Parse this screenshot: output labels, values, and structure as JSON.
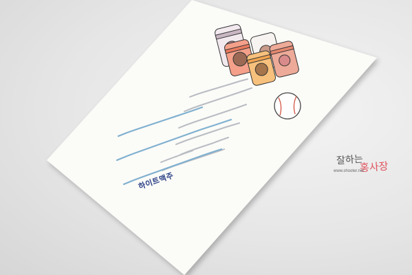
{
  "card": {
    "brand_name": "하이트맥주"
  },
  "watermark": {
    "title": "잘하는",
    "accent": "홍사장",
    "url": "www.shooter.net"
  },
  "colors": {
    "background": "#e4e4e4",
    "card": "#fbfbf8",
    "handwriting_gray": "#b9bcc2",
    "handwriting_blue": "#7fb0cf",
    "brand_blue": "#2a3f86",
    "watermark_accent": "#e0545f"
  },
  "icons": [
    "beer-can-icon",
    "baseball-icon"
  ]
}
